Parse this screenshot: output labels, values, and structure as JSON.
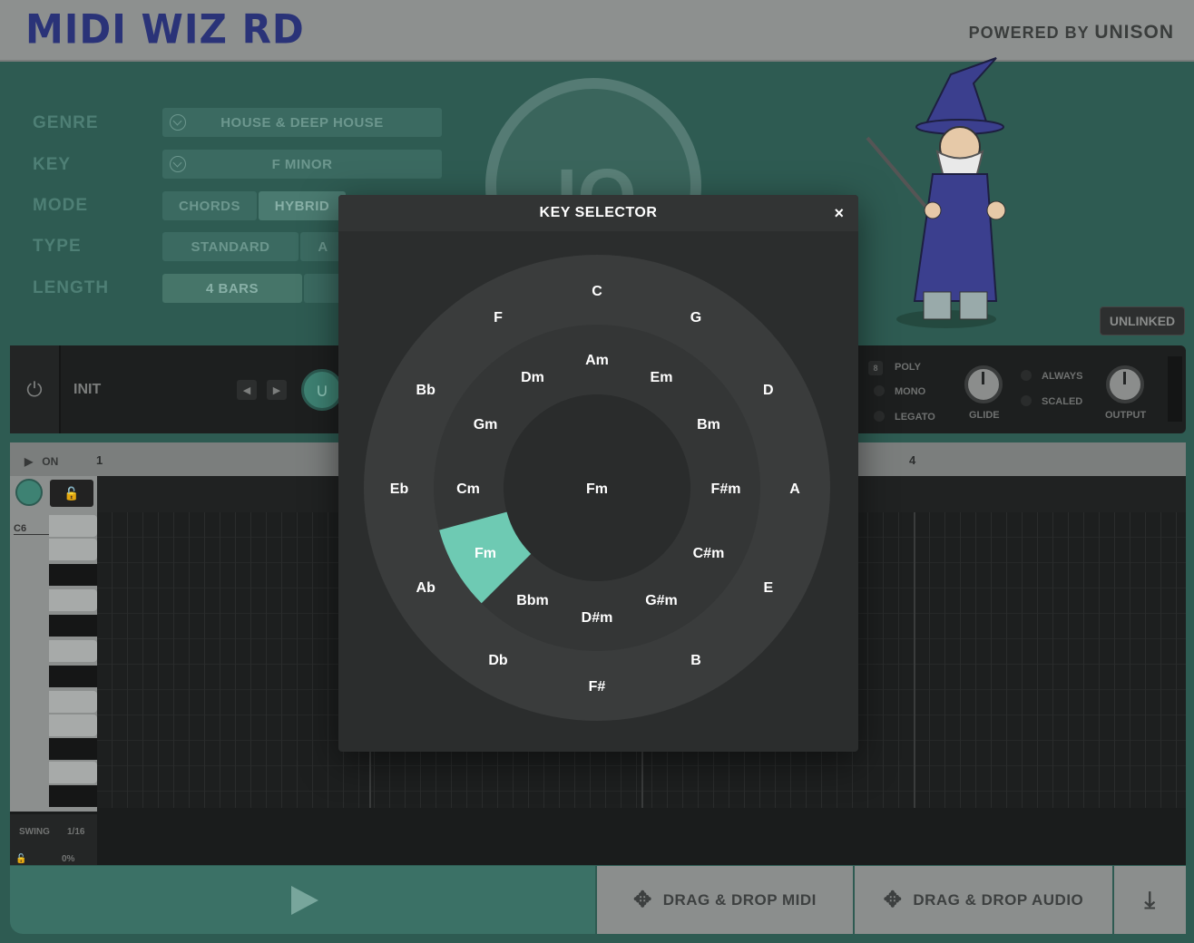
{
  "app": {
    "logo": "MIDI WIZ RD",
    "powered_prefix": "POWERED BY",
    "powered_brand": "UNISON"
  },
  "params": {
    "genre_label": "GENRE",
    "genre_value": "HOUSE & DEEP HOUSE",
    "key_label": "KEY",
    "key_value": "F MINOR",
    "mode_label": "MODE",
    "mode_opt1": "CHORDS",
    "mode_opt2": "HYBRID",
    "type_label": "TYPE",
    "type_opt1": "STANDARD",
    "type_opt2": "A",
    "length_label": "LENGTH",
    "length_value": "4 BARS"
  },
  "unlinked_label": "UNLINKED",
  "strip": {
    "preset_name": "INIT",
    "voice_count": "8",
    "poly": "POLY",
    "mono": "MONO",
    "legato": "LEGATO",
    "glide": "GLIDE",
    "always": "ALWAYS",
    "scaled": "SCALED",
    "output": "OUTPUT"
  },
  "sequencer": {
    "on_label": "ON",
    "bar1": "1",
    "bar4": "4",
    "octave_label": "C6",
    "swing_label": "SWING",
    "swing_div": "1/16",
    "swing_value": "0%"
  },
  "bottom": {
    "drag_midi": "DRAG & DROP MIDI",
    "drag_audio": "DRAG & DROP AUDIO"
  },
  "modal": {
    "title": "KEY SELECTOR",
    "close": "×",
    "center_label": "Fm",
    "selected": "Fm",
    "accent": "#6ecab3",
    "outer_keys": [
      "C",
      "G",
      "D",
      "A",
      "E",
      "B",
      "F#",
      "Db",
      "Ab",
      "Eb",
      "Bb",
      "F"
    ],
    "inner_keys": [
      "Am",
      "Em",
      "Bm",
      "F#m",
      "C#m",
      "G#m",
      "D#m",
      "Bbm",
      "Fm",
      "Cm",
      "Gm",
      "Dm"
    ]
  }
}
